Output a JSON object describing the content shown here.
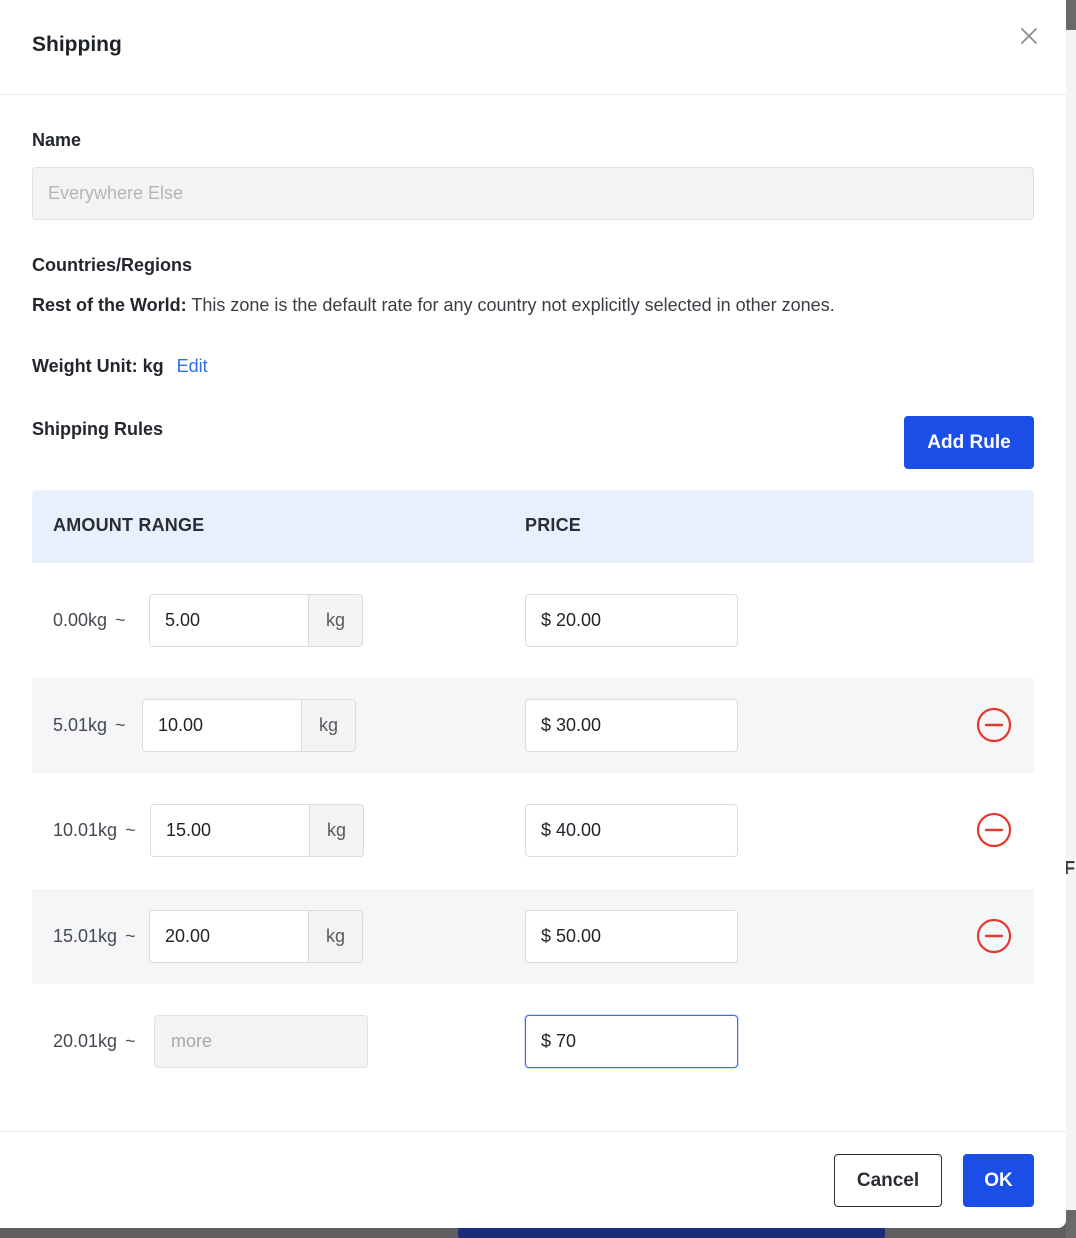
{
  "modal": {
    "title": "Shipping",
    "name_label": "Name",
    "name_placeholder": "Everywhere Else",
    "regions_label": "Countries/Regions",
    "regions_desc_bold": "Rest of the World:",
    "regions_desc_text": " This zone is the default rate for any country not explicitly selected in other zones.",
    "weight_unit_label": "Weight Unit: kg",
    "edit_label": "Edit",
    "shipping_rules_label": "Shipping Rules",
    "add_rule_label": "Add Rule"
  },
  "table": {
    "col_range": "AMOUNT RANGE",
    "col_price": "PRICE",
    "tilde": "~",
    "unit": "kg",
    "currency": "$",
    "rows": [
      {
        "from": "0.00kg",
        "to": "5.00",
        "price": "20.00"
      },
      {
        "from": "5.01kg",
        "to": "10.00",
        "price": "30.00"
      },
      {
        "from": "10.01kg",
        "to": "15.00",
        "price": "40.00"
      },
      {
        "from": "15.01kg",
        "to": "20.00",
        "price": "50.00"
      },
      {
        "from": "20.01kg",
        "to_placeholder": "more",
        "price": "70"
      }
    ]
  },
  "footer": {
    "cancel_label": "Cancel",
    "ok_label": "OK"
  },
  "backdrop": {
    "fragment_text": "F"
  },
  "colors": {
    "primary": "#1b4ee6",
    "link": "#2f6fe3",
    "danger": "#e23a2e",
    "header_bg": "#e8f0fd"
  }
}
